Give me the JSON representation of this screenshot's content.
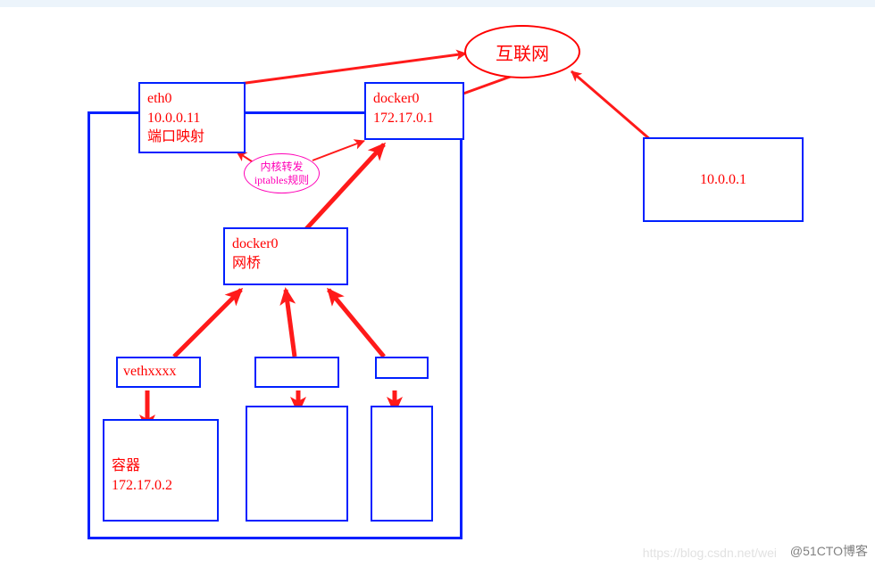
{
  "internet": {
    "label": "互联网"
  },
  "eth0": {
    "name": "eth0",
    "ip": "10.0.0.11",
    "portmap": "端口映射"
  },
  "docker0_top": {
    "name": "docker0",
    "ip": "172.17.0.1"
  },
  "kernel": {
    "line1": "内核转发",
    "line2": "iptables规则"
  },
  "gateway": {
    "ip": "10.0.0.1"
  },
  "docker0_bridge": {
    "name": "docker0",
    "type": "网桥"
  },
  "veth": {
    "name": "vethxxxx"
  },
  "container": {
    "name": "容器",
    "ip": "172.17.0.2"
  },
  "watermark": {
    "faint": "https://blog.csdn.net/wei",
    "dark": "@51CTO博客"
  },
  "colors": {
    "blue": "#0020ff",
    "red": "#ff0000",
    "magenta": "#ff00b7",
    "arrow": "#ff1a1a"
  }
}
